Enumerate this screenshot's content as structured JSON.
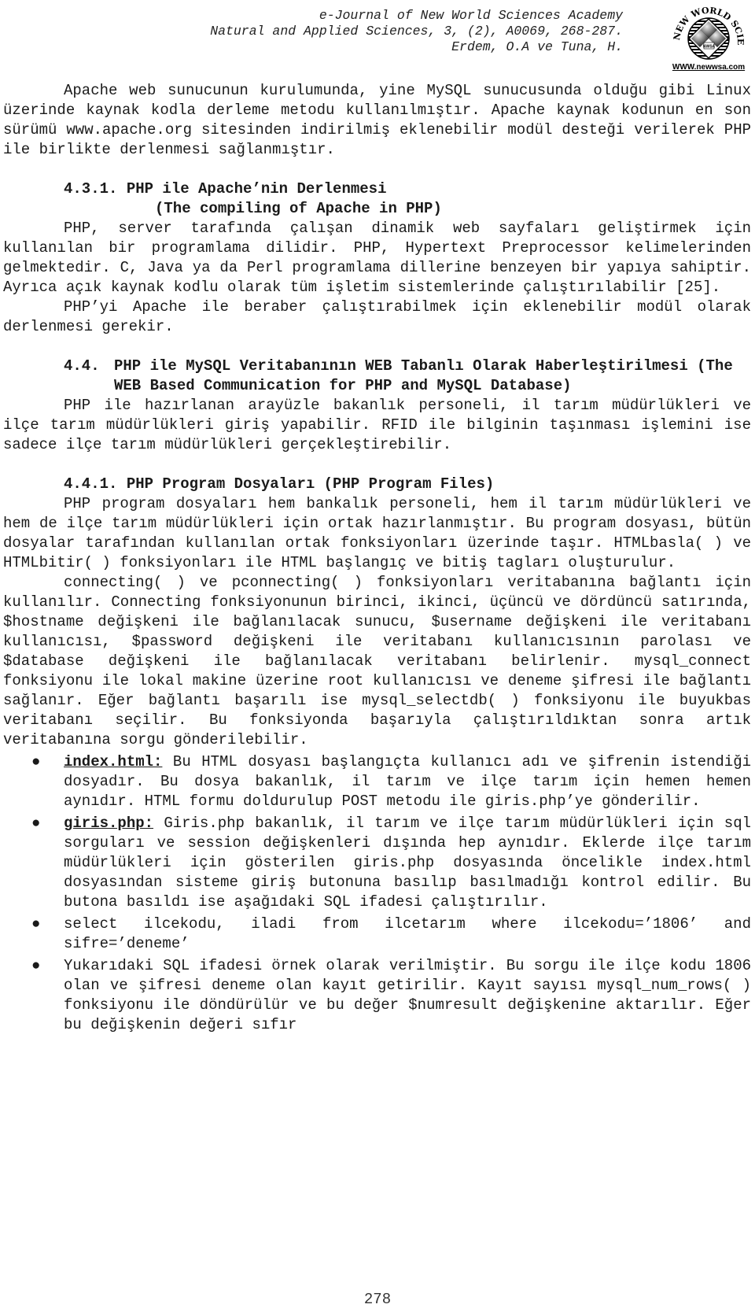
{
  "header": {
    "journal": "e-Journal of New World Sciences Academy",
    "citation": "Natural and Applied Sciences, 3, (2), A0069, 268-287.",
    "authors": "Erdem, O.A ve Tuna, H.",
    "logo": {
      "top_text": "NEW WORLD SCIENCES ACADEMY",
      "center_text": "NWSA",
      "url_text": "WWW.newwsa.com"
    }
  },
  "body": {
    "intro_paragraph": "Apache web sunucunun kurulumunda, yine MySQL sunucusunda olduğu gibi Linux üzerinde kaynak kodla derleme metodu kullanılmıştır. Apache kaynak kodunun en son sürümü www.apache.org sitesinden indirilmiş eklenebilir modül desteği verilerek PHP ile birlikte derlenmesi sağlanmıştır.",
    "section_431": {
      "heading": "4.3.1. PHP ile Apache’nin Derlenmesi",
      "subheading": "(The compiling of Apache in PHP)",
      "paragraphs": [
        "PHP, server tarafında çalışan dinamik web sayfaları geliştirmek için kullanılan bir programlama dilidir. PHP, Hypertext Preprocessor kelimelerinden gelmektedir. C, Java ya da Perl programlama dillerine benzeyen bir yapıya sahiptir. Ayrıca açık kaynak kodlu olarak tüm işletim sistemlerinde çalıştırılabilir [25].",
        "PHP’yi Apache ile beraber çalıştırabilmek için eklenebilir modül olarak derlenmesi gerekir."
      ]
    },
    "section_44": {
      "number": "4.4.",
      "heading": "PHP ile MySQL Veritabanının WEB Tabanlı Olarak Haberleştirilmesi (The WEB Based Communication for PHP and MySQL Database)",
      "paragraph": "PHP ile hazırlanan arayüzle bakanlık personeli, il tarım müdürlükleri ve ilçe tarım müdürlükleri giriş yapabilir. RFID ile bilginin taşınması işlemini ise sadece ilçe tarım müdürlükleri gerçekleştirebilir."
    },
    "section_441": {
      "heading": "4.4.1. PHP Program Dosyaları (PHP Program Files)",
      "paragraphs": [
        "PHP program dosyaları hem bankalık personeli, hem il tarım müdürlükleri ve hem de ilçe tarım müdürlükleri için ortak hazırlanmıştır. Bu program dosyası, bütün dosyalar tarafından kullanılan ortak fonksiyonları üzerinde taşır. HTMLbasla( ) ve HTMLbitir( ) fonksiyonları ile HTML başlangıç ve bitiş tagları oluşturulur.",
        "connecting( ) ve pconnecting( ) fonksiyonları veritabanına bağlantı için kullanılır. Connecting fonksiyonunun birinci, ikinci, üçüncü ve dördüncü satırında, $hostname değişkeni ile bağlanılacak sunucu, $username değişkeni ile veritabanı kullanıcısı, $password değişkeni ile veritabanı kullanıcısının parolası ve $database değişkeni ile bağlanılacak veritabanı belirlenir. mysql_connect fonksiyonu ile lokal makine üzerine root kullanıcısı ve deneme şifresi ile bağlantı sağlanır. Eğer bağlantı başarılı ise mysql_selectdb( ) fonksiyonu ile buyukbas veritabanı seçilir. Bu fonksiyonda başarıyla çalıştırıldıktan sonra artık veritabanına sorgu gönderilebilir."
      ],
      "bullets": [
        {
          "term": "index.html:",
          "text": " Bu HTML dosyası başlangıçta kullanıcı adı ve şifrenin istendiği dosyadır. Bu dosya bakanlık, il tarım ve ilçe tarım için hemen hemen aynıdır. HTML formu doldurulup POST metodu ile giris.php’ye gönderilir."
        },
        {
          "term": "giris.php:",
          "text": " Giris.php bakanlık, il tarım ve ilçe tarım müdürlükleri için sql sorguları ve session değişkenleri dışında hep aynıdır. Eklerde ilçe tarım müdürlükleri için gösterilen giris.php dosyasında öncelikle index.html dosyasından sisteme giriş butonuna basılıp basılmadığı kontrol edilir. Bu butona basıldı ise aşağıdaki SQL ifadesi çalıştırılır."
        },
        {
          "term": "",
          "text": "select ilcekodu, iladi from ilcetarım where ilcekodu=’1806’ and sifre=’deneme’"
        },
        {
          "term": "",
          "text": "Yukarıdaki SQL ifadesi örnek olarak verilmiştir. Bu sorgu ile ilçe kodu 1806 olan ve şifresi deneme olan kayıt getirilir. Kayıt sayısı mysql_num_rows( ) fonksiyonu ile döndürülür ve bu değer $numresult değişkenine aktarılır. Eğer bu değişkenin değeri sıfır"
        }
      ]
    }
  },
  "footer": {
    "page_number": "278"
  }
}
